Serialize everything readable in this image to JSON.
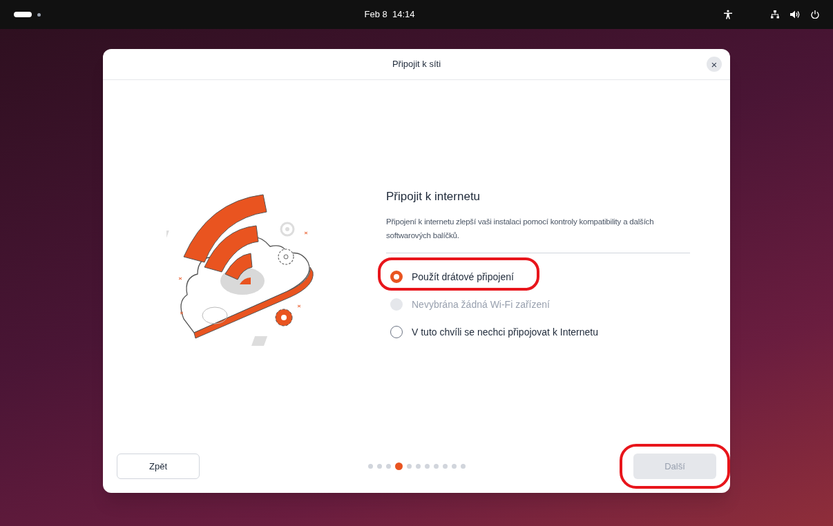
{
  "top_bar": {
    "clock": "Feb 8  14:14"
  },
  "dialog": {
    "title": "Připojit k síti",
    "close": "×"
  },
  "heading": "Připojit k internetu",
  "description": "Připojení k internetu zlepší vaši instalaci pomocí kontroly kompatibility a dalších softwarových balíčků.",
  "options": [
    {
      "label": "Použít drátové připojení",
      "selected": true,
      "disabled": false,
      "highlighted": true
    },
    {
      "label": "Nevybrána žádná Wi-Fi zařízení",
      "selected": false,
      "disabled": true,
      "highlighted": false
    },
    {
      "label": "V tuto chvíli se nechci připojovat k Internetu",
      "selected": false,
      "disabled": false,
      "highlighted": false
    }
  ],
  "back_button": {
    "label": "Zpět"
  },
  "pager": [
    {
      "selected": false
    },
    {
      "selected": false
    },
    {
      "selected": false
    },
    {
      "selected": true
    },
    {
      "selected": false
    },
    {
      "selected": false
    },
    {
      "selected": false
    },
    {
      "selected": false
    },
    {
      "selected": false
    },
    {
      "selected": false
    },
    {
      "selected": false
    }
  ],
  "next_button": {
    "label": "Další",
    "disabled": true,
    "highlighted": true
  }
}
